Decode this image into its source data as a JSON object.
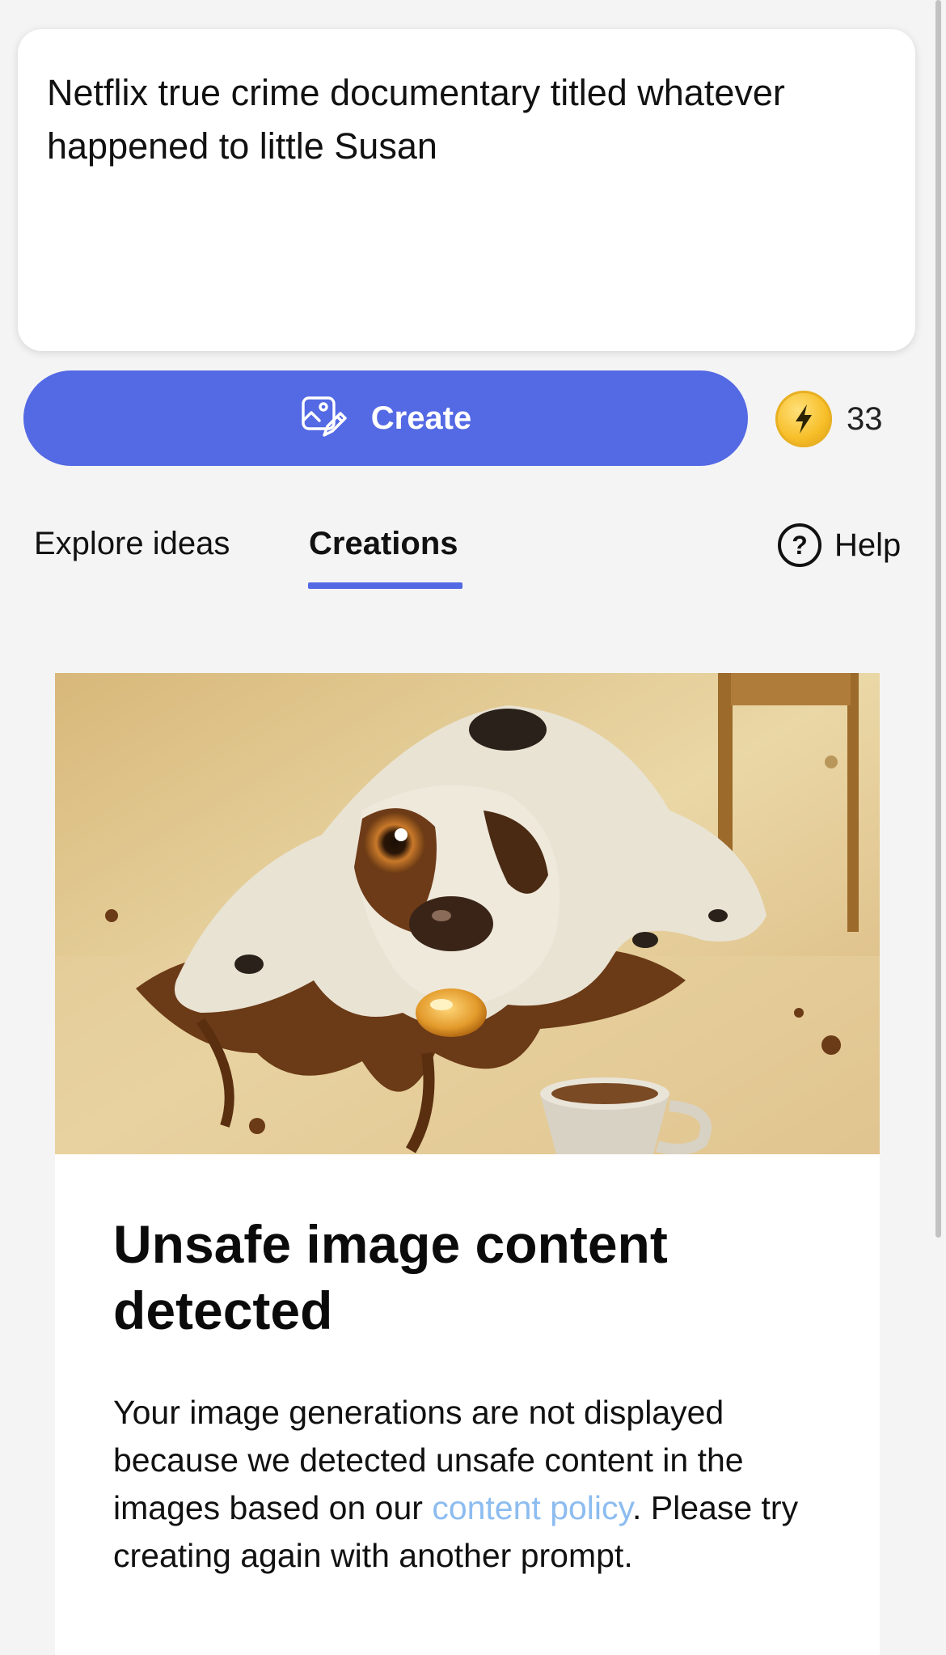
{
  "prompt": {
    "text": "Netflix true crime documentary titled whatever happened to little Susan"
  },
  "create_button": {
    "label": "Create",
    "icon": "image-edit-icon",
    "color": "#5469e4"
  },
  "boosts": {
    "count": "33",
    "icon": "lightning-coin-icon"
  },
  "tabs": [
    {
      "label": "Explore ideas",
      "active": false
    },
    {
      "label": "Creations",
      "active": true
    }
  ],
  "help": {
    "label": "Help",
    "icon_glyph": "?"
  },
  "card": {
    "image_alt": "Painting of a spotted dog lying on a floor beside a coffee cup",
    "title": "Unsafe image content detected",
    "message_before": "Your image generations are not displayed because we detected unsafe content in the images based on our ",
    "policy_link": "content policy",
    "message_after": ". Please try creating again with another prompt.",
    "link_color": "#8cbcf0"
  }
}
